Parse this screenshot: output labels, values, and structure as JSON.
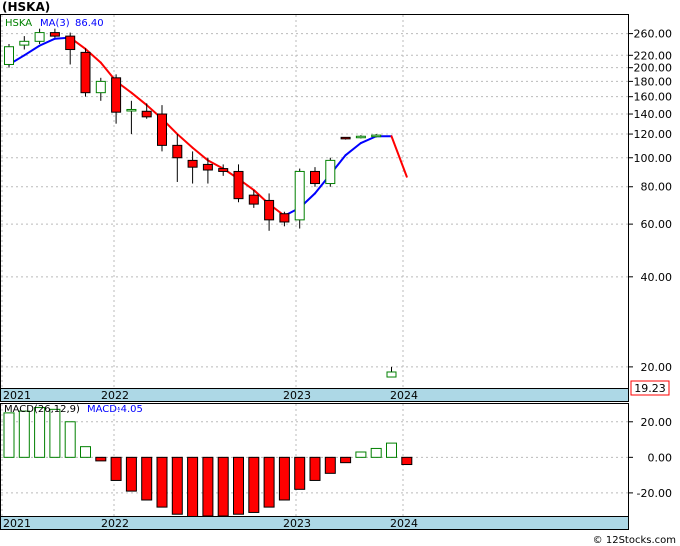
{
  "chart_data": [
    {
      "type": "candlestick",
      "title": "(HSKA)",
      "indicator_label": "MA(3)",
      "indicator_value": "86.40",
      "scale": "log",
      "ylim": [
        17,
        300
      ],
      "y_ticks": [
        "260.00",
        "220.00",
        "200.00",
        "180.00",
        "160.00",
        "140.00",
        "120.00",
        "100.00",
        "80.00",
        "60.00",
        "40.00",
        "20.00"
      ],
      "x_ticks": [
        "2021",
        "2022",
        "2023",
        "2024"
      ],
      "last_price": "19.23",
      "grid": true,
      "colors": {
        "up": "#008000",
        "down": "#ff0000",
        "ma_up": "#0000ff",
        "ma_down": "#ff0000",
        "axis_band": "#add8e6"
      },
      "candles": [
        {
          "o": 205,
          "h": 240,
          "l": 200,
          "c": 235
        },
        {
          "o": 238,
          "h": 255,
          "l": 230,
          "c": 245
        },
        {
          "o": 245,
          "h": 270,
          "l": 240,
          "c": 262
        },
        {
          "o": 262,
          "h": 270,
          "l": 252,
          "c": 255
        },
        {
          "o": 255,
          "h": 262,
          "l": 205,
          "c": 230
        },
        {
          "o": 225,
          "h": 232,
          "l": 160,
          "c": 165
        },
        {
          "o": 165,
          "h": 185,
          "l": 155,
          "c": 180
        },
        {
          "o": 185,
          "h": 190,
          "l": 130,
          "c": 142
        },
        {
          "o": 145,
          "h": 155,
          "l": 120,
          "c": 145
        },
        {
          "o": 143,
          "h": 152,
          "l": 135,
          "c": 137
        },
        {
          "o": 140,
          "h": 150,
          "l": 105,
          "c": 110
        },
        {
          "o": 110,
          "h": 120,
          "l": 83,
          "c": 100
        },
        {
          "o": 98,
          "h": 105,
          "l": 82,
          "c": 93
        },
        {
          "o": 95,
          "h": 100,
          "l": 82,
          "c": 91
        },
        {
          "o": 92,
          "h": 95,
          "l": 87,
          "c": 90
        },
        {
          "o": 90,
          "h": 95,
          "l": 71,
          "c": 73
        },
        {
          "o": 75,
          "h": 78,
          "l": 68,
          "c": 70
        },
        {
          "o": 72,
          "h": 76,
          "l": 57,
          "c": 62
        },
        {
          "o": 65,
          "h": 66,
          "l": 59,
          "c": 61
        },
        {
          "o": 62,
          "h": 92,
          "l": 58,
          "c": 90
        },
        {
          "o": 90,
          "h": 93,
          "l": 80,
          "c": 82
        },
        {
          "o": 82,
          "h": 100,
          "l": 80,
          "c": 98
        },
        {
          "o": 117,
          "h": 117,
          "l": 115,
          "c": 116
        },
        {
          "o": 117,
          "h": 119,
          "l": 116,
          "c": 118
        },
        {
          "o": 118,
          "h": 120,
          "l": 117,
          "c": 119
        },
        {
          "o": 18.5,
          "h": 20,
          "l": 18.5,
          "c": 19.23
        }
      ],
      "ma_values": [
        205,
        220,
        237,
        250,
        252,
        231,
        208,
        180,
        165,
        150,
        135,
        120,
        108,
        98,
        92,
        85,
        78,
        70,
        64,
        68,
        76,
        88,
        102,
        112,
        118,
        118,
        86.4
      ]
    },
    {
      "type": "bar",
      "title": "MACD(26,12,9)",
      "indicator_label": "MACD:",
      "indicator_value": "-4.05",
      "ylim": [
        -33,
        30
      ],
      "y_ticks": [
        "20.00",
        "0.00",
        "-20.00"
      ],
      "x_ticks": [
        "2021",
        "2022",
        "2023",
        "2024"
      ],
      "values": [
        25,
        26,
        28,
        27,
        20,
        6,
        -2,
        -13,
        -19,
        -24,
        -28,
        -32,
        -34,
        -33,
        -33,
        -32,
        -31,
        -28,
        -24,
        -18,
        -13,
        -9,
        -3,
        3,
        5,
        8,
        -4.05
      ],
      "colors": {
        "positive": "#008000",
        "negative": "#ff0000"
      }
    }
  ],
  "credit": "© 12Stocks.com"
}
